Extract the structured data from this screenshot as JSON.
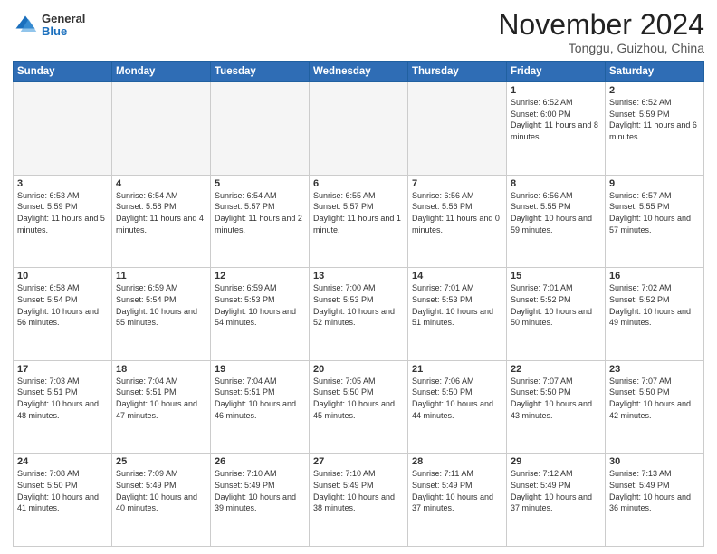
{
  "header": {
    "logo": {
      "general": "General",
      "blue": "Blue"
    },
    "title": "November 2024",
    "location": "Tonggu, Guizhou, China"
  },
  "days_of_week": [
    "Sunday",
    "Monday",
    "Tuesday",
    "Wednesday",
    "Thursday",
    "Friday",
    "Saturday"
  ],
  "weeks": [
    [
      {
        "day": "",
        "empty": true
      },
      {
        "day": "",
        "empty": true
      },
      {
        "day": "",
        "empty": true
      },
      {
        "day": "",
        "empty": true
      },
      {
        "day": "",
        "empty": true
      },
      {
        "day": "1",
        "sunrise": "6:52 AM",
        "sunset": "6:00 PM",
        "daylight": "11 hours and 8 minutes."
      },
      {
        "day": "2",
        "sunrise": "6:52 AM",
        "sunset": "5:59 PM",
        "daylight": "11 hours and 6 minutes."
      }
    ],
    [
      {
        "day": "3",
        "sunrise": "6:53 AM",
        "sunset": "5:59 PM",
        "daylight": "11 hours and 5 minutes."
      },
      {
        "day": "4",
        "sunrise": "6:54 AM",
        "sunset": "5:58 PM",
        "daylight": "11 hours and 4 minutes."
      },
      {
        "day": "5",
        "sunrise": "6:54 AM",
        "sunset": "5:57 PM",
        "daylight": "11 hours and 2 minutes."
      },
      {
        "day": "6",
        "sunrise": "6:55 AM",
        "sunset": "5:57 PM",
        "daylight": "11 hours and 1 minute."
      },
      {
        "day": "7",
        "sunrise": "6:56 AM",
        "sunset": "5:56 PM",
        "daylight": "11 hours and 0 minutes."
      },
      {
        "day": "8",
        "sunrise": "6:56 AM",
        "sunset": "5:55 PM",
        "daylight": "10 hours and 59 minutes."
      },
      {
        "day": "9",
        "sunrise": "6:57 AM",
        "sunset": "5:55 PM",
        "daylight": "10 hours and 57 minutes."
      }
    ],
    [
      {
        "day": "10",
        "sunrise": "6:58 AM",
        "sunset": "5:54 PM",
        "daylight": "10 hours and 56 minutes."
      },
      {
        "day": "11",
        "sunrise": "6:59 AM",
        "sunset": "5:54 PM",
        "daylight": "10 hours and 55 minutes."
      },
      {
        "day": "12",
        "sunrise": "6:59 AM",
        "sunset": "5:53 PM",
        "daylight": "10 hours and 54 minutes."
      },
      {
        "day": "13",
        "sunrise": "7:00 AM",
        "sunset": "5:53 PM",
        "daylight": "10 hours and 52 minutes."
      },
      {
        "day": "14",
        "sunrise": "7:01 AM",
        "sunset": "5:53 PM",
        "daylight": "10 hours and 51 minutes."
      },
      {
        "day": "15",
        "sunrise": "7:01 AM",
        "sunset": "5:52 PM",
        "daylight": "10 hours and 50 minutes."
      },
      {
        "day": "16",
        "sunrise": "7:02 AM",
        "sunset": "5:52 PM",
        "daylight": "10 hours and 49 minutes."
      }
    ],
    [
      {
        "day": "17",
        "sunrise": "7:03 AM",
        "sunset": "5:51 PM",
        "daylight": "10 hours and 48 minutes."
      },
      {
        "day": "18",
        "sunrise": "7:04 AM",
        "sunset": "5:51 PM",
        "daylight": "10 hours and 47 minutes."
      },
      {
        "day": "19",
        "sunrise": "7:04 AM",
        "sunset": "5:51 PM",
        "daylight": "10 hours and 46 minutes."
      },
      {
        "day": "20",
        "sunrise": "7:05 AM",
        "sunset": "5:50 PM",
        "daylight": "10 hours and 45 minutes."
      },
      {
        "day": "21",
        "sunrise": "7:06 AM",
        "sunset": "5:50 PM",
        "daylight": "10 hours and 44 minutes."
      },
      {
        "day": "22",
        "sunrise": "7:07 AM",
        "sunset": "5:50 PM",
        "daylight": "10 hours and 43 minutes."
      },
      {
        "day": "23",
        "sunrise": "7:07 AM",
        "sunset": "5:50 PM",
        "daylight": "10 hours and 42 minutes."
      }
    ],
    [
      {
        "day": "24",
        "sunrise": "7:08 AM",
        "sunset": "5:50 PM",
        "daylight": "10 hours and 41 minutes."
      },
      {
        "day": "25",
        "sunrise": "7:09 AM",
        "sunset": "5:49 PM",
        "daylight": "10 hours and 40 minutes."
      },
      {
        "day": "26",
        "sunrise": "7:10 AM",
        "sunset": "5:49 PM",
        "daylight": "10 hours and 39 minutes."
      },
      {
        "day": "27",
        "sunrise": "7:10 AM",
        "sunset": "5:49 PM",
        "daylight": "10 hours and 38 minutes."
      },
      {
        "day": "28",
        "sunrise": "7:11 AM",
        "sunset": "5:49 PM",
        "daylight": "10 hours and 37 minutes."
      },
      {
        "day": "29",
        "sunrise": "7:12 AM",
        "sunset": "5:49 PM",
        "daylight": "10 hours and 37 minutes."
      },
      {
        "day": "30",
        "sunrise": "7:13 AM",
        "sunset": "5:49 PM",
        "daylight": "10 hours and 36 minutes."
      }
    ]
  ]
}
